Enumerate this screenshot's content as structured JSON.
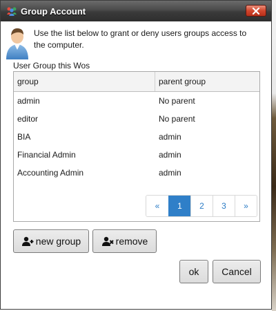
{
  "window": {
    "title": "Group Account",
    "close_icon": "close-icon"
  },
  "instructions": "Use the list below to grant or deny users groups access to the computer.",
  "list": {
    "label": "User Group this Wos",
    "columns": [
      "group",
      "parent group"
    ],
    "rows": [
      {
        "group": "admin",
        "parent": "No parent"
      },
      {
        "group": "editor",
        "parent": "No parent"
      },
      {
        "group": "BIA",
        "parent": "admin"
      },
      {
        "group": "Financial Admin",
        "parent": "admin"
      },
      {
        "group": "Accounting Admin",
        "parent": "admin"
      }
    ]
  },
  "pagination": {
    "prev": "«",
    "pages": [
      "1",
      "2",
      "3"
    ],
    "next": "»",
    "active_page": "1"
  },
  "actions": {
    "new_group_label": "new group",
    "remove_label": "remove",
    "ok_label": "ok",
    "cancel_label": "Cancel"
  },
  "colors": {
    "accent": "#2f7fc8",
    "titlebar": "#3a3a3a",
    "close": "#c8381f"
  }
}
